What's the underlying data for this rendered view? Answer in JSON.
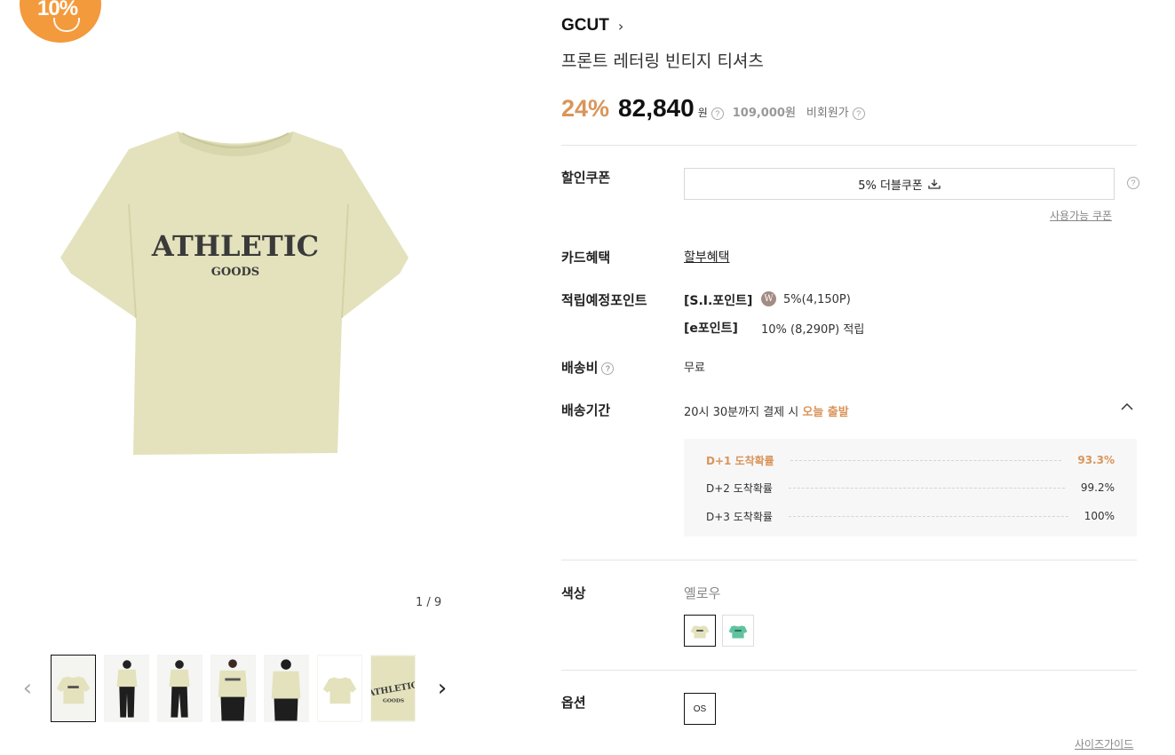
{
  "badge": {
    "text": "10%"
  },
  "gallery": {
    "counter": "1 / 9",
    "thumb_count": 7,
    "main_print_line1": "ATHLETIC",
    "main_print_line2": "GOODS"
  },
  "product": {
    "brand": "GCUT",
    "title": "프론트 레터링 빈티지 티셔츠"
  },
  "price": {
    "discount": "24%",
    "sale": "82,840",
    "won": "원",
    "original": "109,000원",
    "member_label": "비회원가"
  },
  "coupon": {
    "label": "할인쿠폰",
    "button": "5% 더블쿠폰",
    "usable": "사용가능 쿠폰"
  },
  "card": {
    "label": "카드혜택",
    "link": "할부혜택"
  },
  "points": {
    "label": "적립예정포인트",
    "si_label": "[S.I.포인트]",
    "si_icon": "W",
    "si_value": "5%(4,150P)",
    "e_label": "[e포인트]",
    "e_value": "10% (8,290P) 적립"
  },
  "shipping": {
    "label": "배송비",
    "value": "무료"
  },
  "delivery": {
    "label": "배송기간",
    "text_prefix": "20시 30분까지 결제 시 ",
    "text_highlight": "오늘 출발",
    "rows": [
      {
        "label": "D+1 도착확률",
        "value": "93.3%"
      },
      {
        "label": "D+2 도착확률",
        "value": "99.2%"
      },
      {
        "label": "D+3 도착확률",
        "value": "100%"
      }
    ]
  },
  "color": {
    "label": "색상",
    "value": "옐로우",
    "swatches": [
      {
        "name": "yellow",
        "hex": "#e3e2bc"
      },
      {
        "name": "green",
        "hex": "#5fc3a0"
      }
    ]
  },
  "option": {
    "label": "옵션",
    "value": "OS"
  },
  "size_guide": "사이즈가이드",
  "colors": {
    "accent": "#d9955a",
    "badge": "#f39a3c",
    "shirt": "#e3e2bc",
    "shirt_shade": "#d8d6ac",
    "print": "#3a3a3a"
  }
}
